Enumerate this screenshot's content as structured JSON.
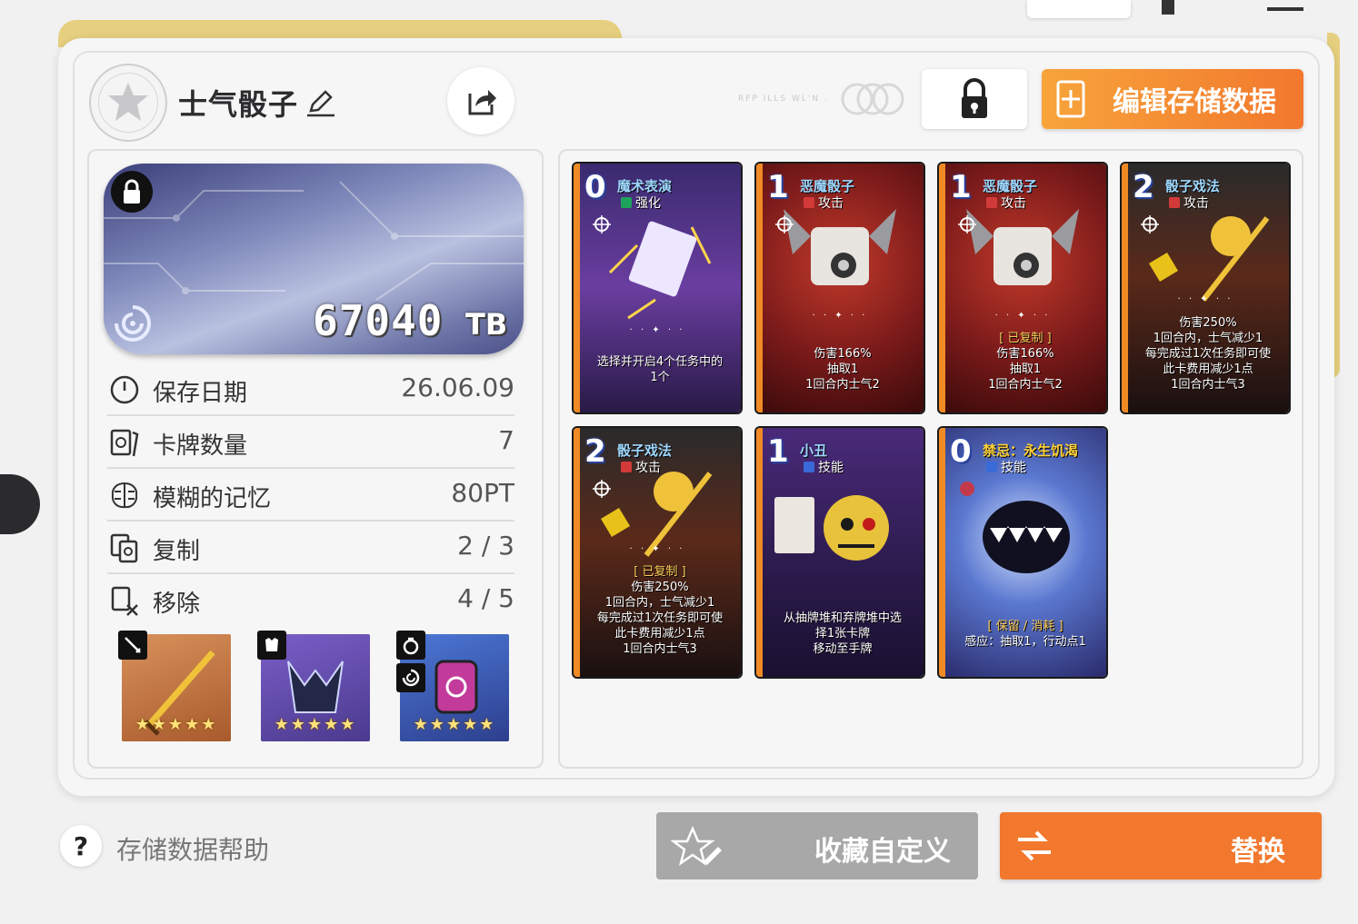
{
  "profile": {
    "name": "士气骰子"
  },
  "faint_text": "RFP ILLS WL'N .",
  "header": {
    "edit_button": "编辑存储数据"
  },
  "banner": {
    "amount": "67040",
    "unit": "TB"
  },
  "stats": [
    {
      "label": "保存日期",
      "value": "26.06.09",
      "icon": "clock-icon"
    },
    {
      "label": "卡牌数量",
      "value": "7",
      "icon": "cards-icon"
    },
    {
      "label": "模糊的记忆",
      "value": "80PT",
      "icon": "brain-icon"
    },
    {
      "label": "复制",
      "value": "2 / 3",
      "icon": "copy-icon"
    },
    {
      "label": "移除",
      "value": "4 / 5",
      "icon": "remove-icon"
    }
  ],
  "equipment": [
    {
      "slot": "sword",
      "stars": "★★★★★",
      "color": "#c9703a"
    },
    {
      "slot": "armor",
      "stars": "★★★★★",
      "color": "#6a52b0"
    },
    {
      "slot": "ring",
      "stars": "★★★★★",
      "color": "#3d62b8"
    }
  ],
  "cards": [
    {
      "cost": "0",
      "name": "魔术表演",
      "type": "强化",
      "tag": "",
      "lines": [
        "选择并开启4个任务中的1个"
      ],
      "theme": "purple"
    },
    {
      "cost": "1",
      "name": "恶魔骰子",
      "type": "攻击",
      "tag": "",
      "lines": [
        "伤害166%",
        "抽取1",
        "1回合内士气2"
      ],
      "theme": "red"
    },
    {
      "cost": "1",
      "name": "恶魔骰子",
      "type": "攻击",
      "tag": "[ 已复制 ]",
      "lines": [
        "伤害166%",
        "抽取1",
        "1回合内士气2"
      ],
      "theme": "red"
    },
    {
      "cost": "2",
      "name": "骰子戏法",
      "type": "攻击",
      "tag": "",
      "lines": [
        "伤害250%",
        "1回合内，士气减少1",
        "每完成过1次任务即可使",
        "此卡费用减少1点",
        "1回合内士气3"
      ],
      "theme": "dark"
    },
    {
      "cost": "2",
      "name": "骰子戏法",
      "type": "攻击",
      "tag": "[ 已复制 ]",
      "lines": [
        "伤害250%",
        "1回合内，士气减少1",
        "每完成过1次任务即可使",
        "此卡费用减少1点",
        "1回合内士气3"
      ],
      "theme": "dark"
    },
    {
      "cost": "1",
      "name": "小丑",
      "type": "技能",
      "tag": "",
      "lines": [
        "从抽牌堆和弃牌堆中选",
        "择1张卡牌",
        "移动至手牌"
      ],
      "theme": "violet"
    },
    {
      "cost": "0",
      "name": "禁忌：永生饥渴",
      "type": "技能",
      "tag": "[ 保留 / 消耗 ]",
      "lines": [
        "感应：抽取1，行动点1"
      ],
      "theme": "blue"
    }
  ],
  "footer": {
    "help": "存储数据帮助",
    "help_icon_text": "?",
    "favorite_button": "收藏自定义",
    "swap_button": "替换"
  }
}
